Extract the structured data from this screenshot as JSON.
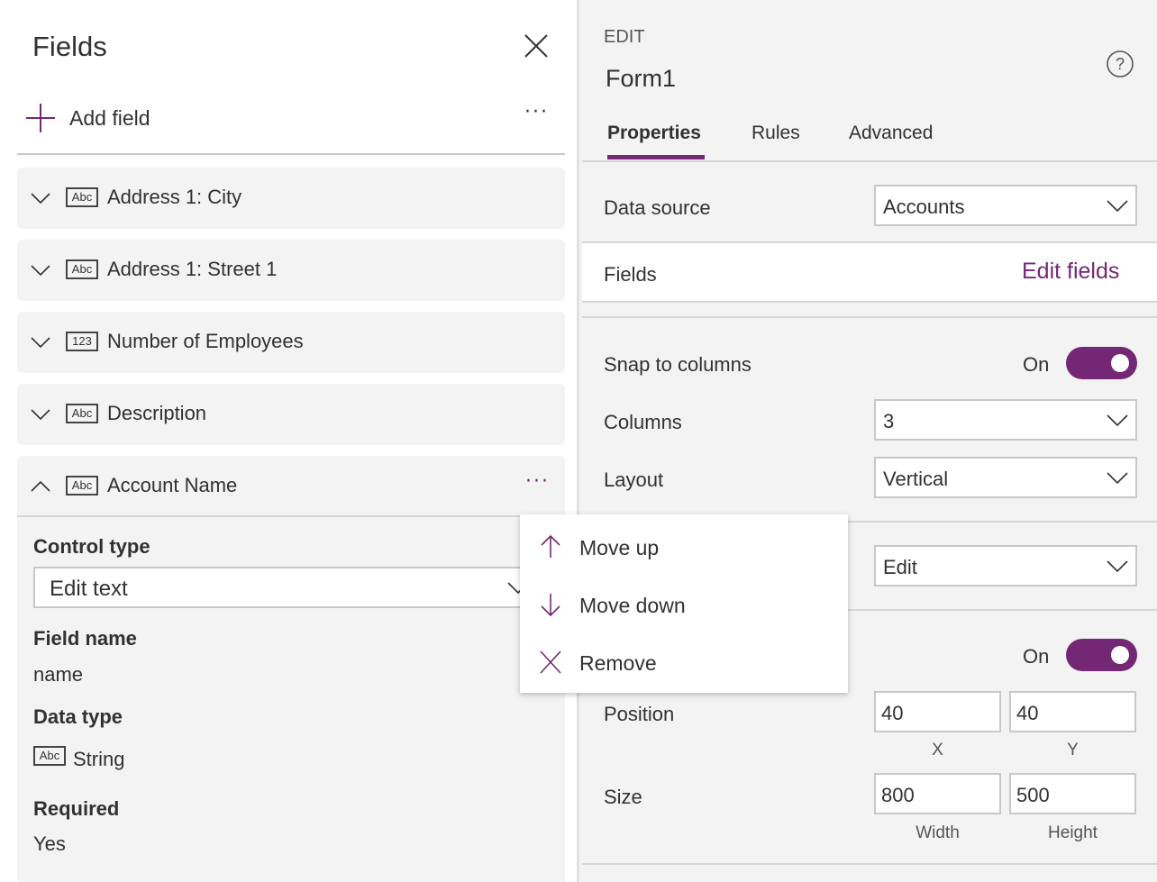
{
  "fields_panel": {
    "title": "Fields",
    "add_field": "Add field",
    "fields": [
      {
        "type_icon": "Abc",
        "label": "Address 1: City",
        "expanded": false
      },
      {
        "type_icon": "Abc",
        "label": "Address 1: Street 1",
        "expanded": false
      },
      {
        "type_icon": "123",
        "label": "Number of Employees",
        "expanded": false
      },
      {
        "type_icon": "Abc",
        "label": "Description",
        "expanded": false
      },
      {
        "type_icon": "Abc",
        "label": "Account Name",
        "expanded": true
      }
    ],
    "details": {
      "control_type_label": "Control type",
      "control_type_value": "Edit text",
      "field_name_label": "Field name",
      "field_name_value": "name",
      "data_type_label": "Data type",
      "data_type_icon": "Abc",
      "data_type_value": "String",
      "required_label": "Required",
      "required_value": "Yes"
    }
  },
  "context_menu": {
    "items": [
      {
        "icon": "arrow-up-icon",
        "label": "Move up"
      },
      {
        "icon": "arrow-down-icon",
        "label": "Move down"
      },
      {
        "icon": "close-icon",
        "label": "Remove"
      }
    ]
  },
  "properties_panel": {
    "mode": "EDIT",
    "name": "Form1",
    "tabs": [
      "Properties",
      "Rules",
      "Advanced"
    ],
    "active_tab": "Properties",
    "data_source_label": "Data source",
    "data_source_value": "Accounts",
    "fields_label": "Fields",
    "edit_fields": "Edit fields",
    "snap_label": "Snap to columns",
    "snap_value": "On",
    "columns_label": "Columns",
    "columns_value": "3",
    "layout_label": "Layout",
    "layout_value": "Vertical",
    "mode_value": "Edit",
    "toggle2_value": "On",
    "position_label": "Position",
    "position_x": "40",
    "position_y": "40",
    "x_label": "X",
    "y_label": "Y",
    "size_label": "Size",
    "size_width": "800",
    "size_height": "500",
    "width_label": "Width",
    "height_label": "Height"
  },
  "colors": {
    "accent": "#742774",
    "panel": "#f3f3f3"
  }
}
